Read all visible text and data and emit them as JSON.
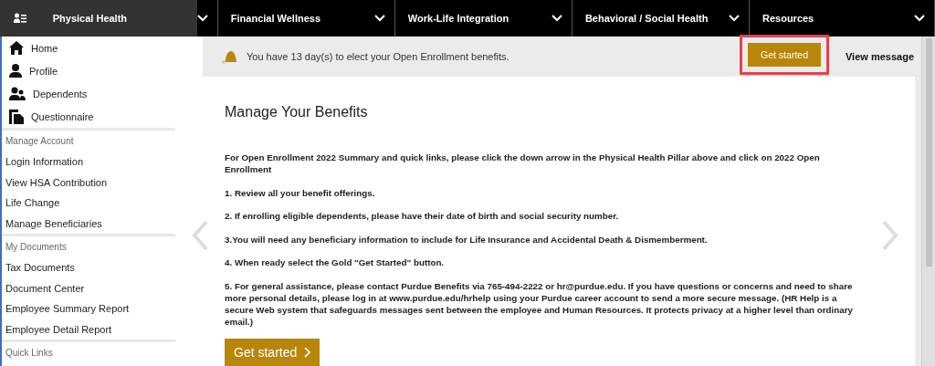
{
  "nav": {
    "items": [
      {
        "label": "Physical Health",
        "selected": true
      },
      {
        "label": "Financial Wellness",
        "selected": false
      },
      {
        "label": "Work-Life Integration",
        "selected": false
      },
      {
        "label": "Behavioral / Social Health",
        "selected": false
      },
      {
        "label": "Resources",
        "selected": false
      }
    ]
  },
  "sidebar": {
    "main_items": [
      {
        "label": "Home",
        "kind": "home"
      },
      {
        "label": "Profile",
        "kind": "person"
      },
      {
        "label": "Dependents",
        "kind": "people"
      },
      {
        "label": "Questionnaire",
        "kind": "document"
      }
    ],
    "sections": [
      {
        "title": "Manage Account",
        "items": [
          "Login Information",
          "View HSA Contribution",
          "Life Change",
          "Manage Beneficiaries"
        ]
      },
      {
        "title": "My Documents",
        "items": [
          "Tax Documents",
          "Document Center",
          "Employee Summary Report",
          "Employee Detail Report"
        ]
      },
      {
        "title": "Quick Links"
      }
    ]
  },
  "notice": {
    "message": "You have 13 day(s) to elect your Open Enrollment benefits.",
    "button": "Get started",
    "button_highlighted": true,
    "link": "View message"
  },
  "card": {
    "title": "Manage Your Benefits",
    "paragraphs": [
      "For Open Enrollment 2022 Summary and quick links, please click the down arrow in the Physical Health Pillar above and click on 2022 Open Enrollment",
      "1. Review all your benefit offerings.",
      "2. If enrolling eligible dependents, please have their date of birth and social security number.",
      "3.You will need any beneficiary information to include for Life Insurance and Accidental Death & Dismemberment.",
      "4. When ready select the Gold \"Get Started\" button.",
      "5. For general assistance, please contact Purdue Benefits via 765-494-2222 or hr@purdue.edu. If you have questions or concerns and need to share more personal details, please log in at www.purdue.edu/hrhelp using your Purdue career account to send a more secure message. (HR Help is a secure Web system that safeguards messages sent between the employee and Human Resources. It protects privacy at a higher level than ordinary email.)"
    ],
    "button": "Get started"
  }
}
